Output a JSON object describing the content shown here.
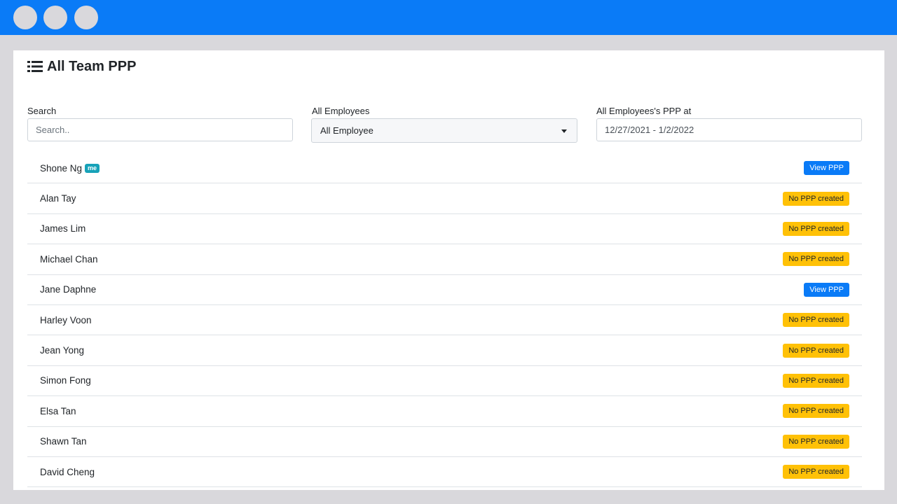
{
  "page": {
    "title": "All Team PPP",
    "icon": "list-icon"
  },
  "filters": {
    "search_label": "Search",
    "search_placeholder": "Search..",
    "search_value": "",
    "employee_label": "All Employees",
    "employee_selected": "All Employee",
    "date_label": "All Employees's PPP at",
    "date_value": "12/27/2021 - 1/2/2022"
  },
  "employees": [
    {
      "name": "Shone Ng",
      "badge": "me",
      "status": "View PPP",
      "status_type": "view"
    },
    {
      "name": "Alan Tay",
      "badge": "",
      "status": "No PPP created",
      "status_type": "none"
    },
    {
      "name": "James Lim",
      "badge": "",
      "status": "No PPP created",
      "status_type": "none"
    },
    {
      "name": "Michael Chan",
      "badge": "",
      "status": "No PPP created",
      "status_type": "none"
    },
    {
      "name": "Jane Daphne",
      "badge": "",
      "status": "View PPP",
      "status_type": "view"
    },
    {
      "name": "Harley Voon",
      "badge": "",
      "status": "No PPP created",
      "status_type": "none"
    },
    {
      "name": "Jean Yong",
      "badge": "",
      "status": "No PPP created",
      "status_type": "none"
    },
    {
      "name": "Simon Fong",
      "badge": "",
      "status": "No PPP created",
      "status_type": "none"
    },
    {
      "name": "Elsa Tan",
      "badge": "",
      "status": "No PPP created",
      "status_type": "none"
    },
    {
      "name": "Shawn Tan",
      "badge": "",
      "status": "No PPP created",
      "status_type": "none"
    },
    {
      "name": "David Cheng",
      "badge": "",
      "status": "No PPP created",
      "status_type": "none"
    }
  ],
  "colors": {
    "titlebar": "#0a7bf7",
    "view_button": "#0a7bf7",
    "no_ppp_badge": "#ffc107",
    "me_badge": "#17a2b8"
  }
}
